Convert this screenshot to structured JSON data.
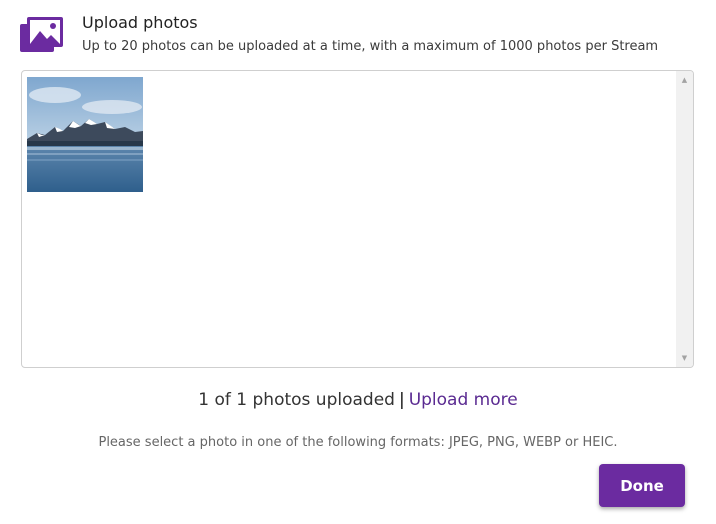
{
  "header": {
    "icon": "photos-icon",
    "title": "Upload photos",
    "subtitle": "Up to 20 photos can be uploaded at a time, with a maximum of 1000 photos per Stream"
  },
  "photos": [
    {
      "icon": "mountain-lake-photo"
    }
  ],
  "status": {
    "uploaded_text": "1 of 1 photos uploaded",
    "separator": "|",
    "upload_more_label": "Upload more"
  },
  "hint": "Please select a photo in one of the following formats: JPEG, PNG, WEBP or HEIC.",
  "done_label": "Done",
  "colors": {
    "accent": "#6b2ba0",
    "link": "#5a2a91"
  }
}
